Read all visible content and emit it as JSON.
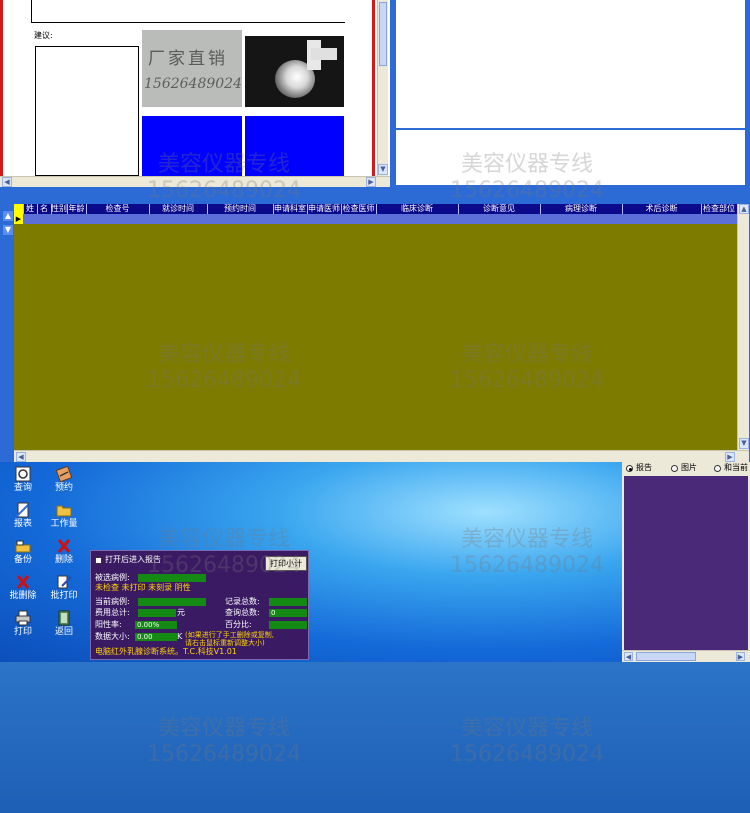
{
  "report_preview": {
    "suggestion_label": "建议:",
    "handwritten_name": "厂家直销",
    "handwritten_phone": "15626489024"
  },
  "table": {
    "columns": [
      "姓",
      "名",
      "性别",
      "年龄",
      "检查号",
      "就诊时间",
      "预约时间",
      "申请科室",
      "申请医师",
      "检查医师",
      "临床诊断",
      "诊断意见",
      "病理诊断",
      "术后诊断",
      "检查部位"
    ]
  },
  "toolbar": {
    "query": "查询",
    "appointment": "预约",
    "report": "报表",
    "workload": "工作量",
    "backup": "备份",
    "delete": "删除",
    "batch_delete": "批删除",
    "batch_print": "批打印",
    "print": "打印",
    "back": "返回"
  },
  "stats": {
    "open_report_checkbox": "打开后进入报告",
    "print_summary_button": "打印小计",
    "selected_cases_label": "被选病例:",
    "status_flags": "未检查  未打印  未刻录  阴性",
    "current_case_label": "当前病例:",
    "fee_total_label": "费用总计:",
    "fee_unit": "元",
    "positive_rate_label": "阳性率:",
    "positive_rate_value": "0.00%",
    "data_size_label": "数据大小:",
    "data_size_value": "0.00",
    "data_size_unit": "K",
    "data_size_note": "(如果进行了手工删除或复制,\n请右击鼠标重新调整大小)",
    "record_total_label": "记录总数:",
    "query_total_label": "查询总数:",
    "query_total_value": "0",
    "percent_label": "百分比:",
    "footer": "电脑红外乳腺诊断系统。T.C.科技V1.01"
  },
  "right_panel": {
    "radio_report": "报告",
    "radio_image": "图片",
    "radio_and": "和当前"
  },
  "watermark": {
    "text": "美容仪器专线",
    "phone": "15626489024"
  },
  "colors": {
    "grid_body": "#7d7b00",
    "grid_header": "#0a0a8a",
    "stats_panel": "#3a1a63",
    "bar_green": "#148a14",
    "stats_text": "#ffd400"
  }
}
